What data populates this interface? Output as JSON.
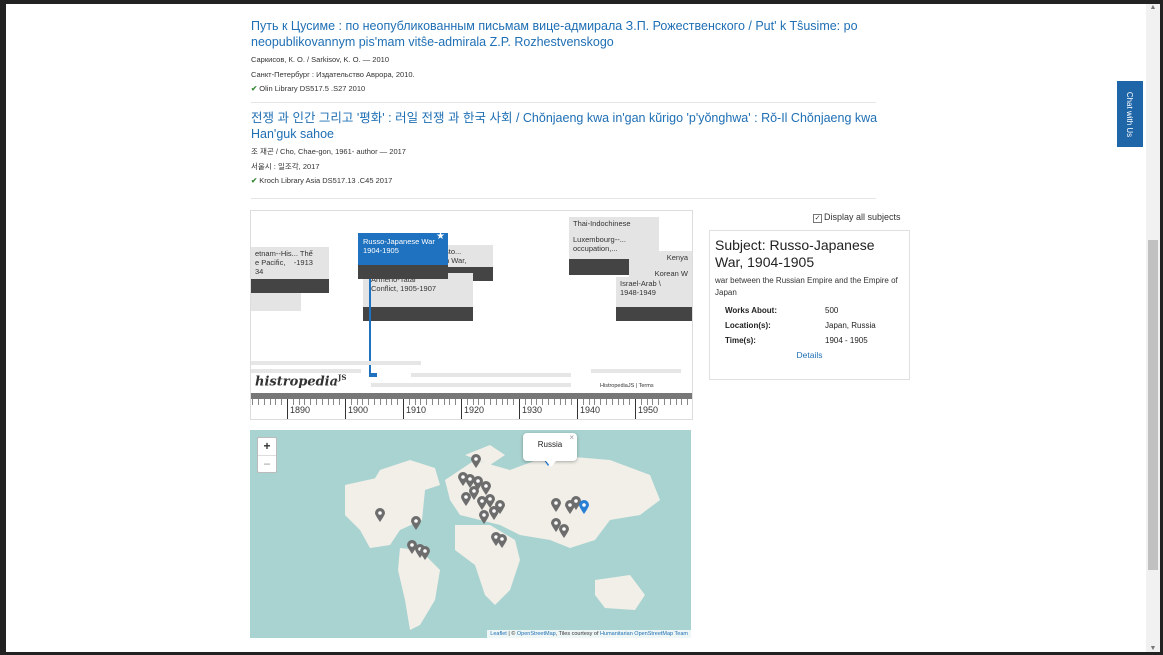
{
  "results": [
    {
      "title": "Путь к Цусиме : по неопубликованным письмам вице-адмирала З.П. Рожественского / Put' k Tŝusime: po neopublikovannym pis'mam vitŝe-admirala Z.P. Rozhestvenskogo",
      "author": "Саркисов, К. О. / Sarkisov, K. O. — 2010",
      "publisher": "Санкт-Петербург : Издательство Аврора, 2010.",
      "location": "Olin Library DS517.5 .S27 2010"
    },
    {
      "title": "전쟁 과 인간 그리고 '평화' : 러일 전쟁 과 한국 사회 / Chŏnjaeng kwa in'gan kŭrigo 'p'yŏnghwa' : Rŏ-Il Chŏnjaeng kwa Han'guk sahoe",
      "author": "조 재곤 / Cho, Chae-gon, 1961- author — 2017",
      "publisher": "서울시 : 일조각, 2017",
      "location": "Kroch Library Asia DS517.13 .C45 2017"
    }
  ],
  "chat_label": "Chat with Us",
  "timeline": {
    "selected_event": "Russo-Japanese War\n1904-1905",
    "events": [
      {
        "label": "etnam--His... Thế\ne Pacific,    -1913\n34"
      },
      {
        "label": "sto...\nn War,"
      },
      {
        "label": "Armeno-Tatar\nConflict, 1905-1907"
      },
      {
        "label": "Thai-Indochinese"
      },
      {
        "label": "Luxembourg--...\noccupation,..."
      },
      {
        "label": "Kenya"
      },
      {
        "label": "Korean W"
      },
      {
        "label": "Israel-Arab \\\n1948-1949"
      }
    ],
    "logo": "histropedia",
    "logo_sup": "JS",
    "credit": "HistropediaJS | Terms",
    "axis_labels": [
      "1890",
      "1900",
      "1910",
      "1920",
      "1930",
      "1940",
      "1950"
    ]
  },
  "subject_panel": {
    "display_all_label": "Display all subjects",
    "title": "Subject: Russo-Japanese War, 1904-1905",
    "description": "war between the Russian Empire and the Empire of Japan",
    "rows": [
      {
        "key": "Works About:",
        "value": "500"
      },
      {
        "key": "Location(s):",
        "value": "Japan, Russia"
      },
      {
        "key": "Time(s):",
        "value": "1904 - 1905"
      }
    ],
    "details_link": "Details"
  },
  "map": {
    "zoom_in": "+",
    "zoom_out": "−",
    "popup_label": "Russia",
    "popup_close": "×",
    "attribution_leaflet": "Leaflet",
    "attribution_mid": " | © ",
    "attribution_osm": "OpenStreetMap",
    "attribution_tiles": ", Tiles courtesy of ",
    "attribution_hot": "Humanitarian OpenStreetMap Team",
    "land_color": "#f2efe9",
    "water_color": "#a9d3d0",
    "marker_gray": "#6d6d6d",
    "marker_blue": "#2a7fd4"
  }
}
